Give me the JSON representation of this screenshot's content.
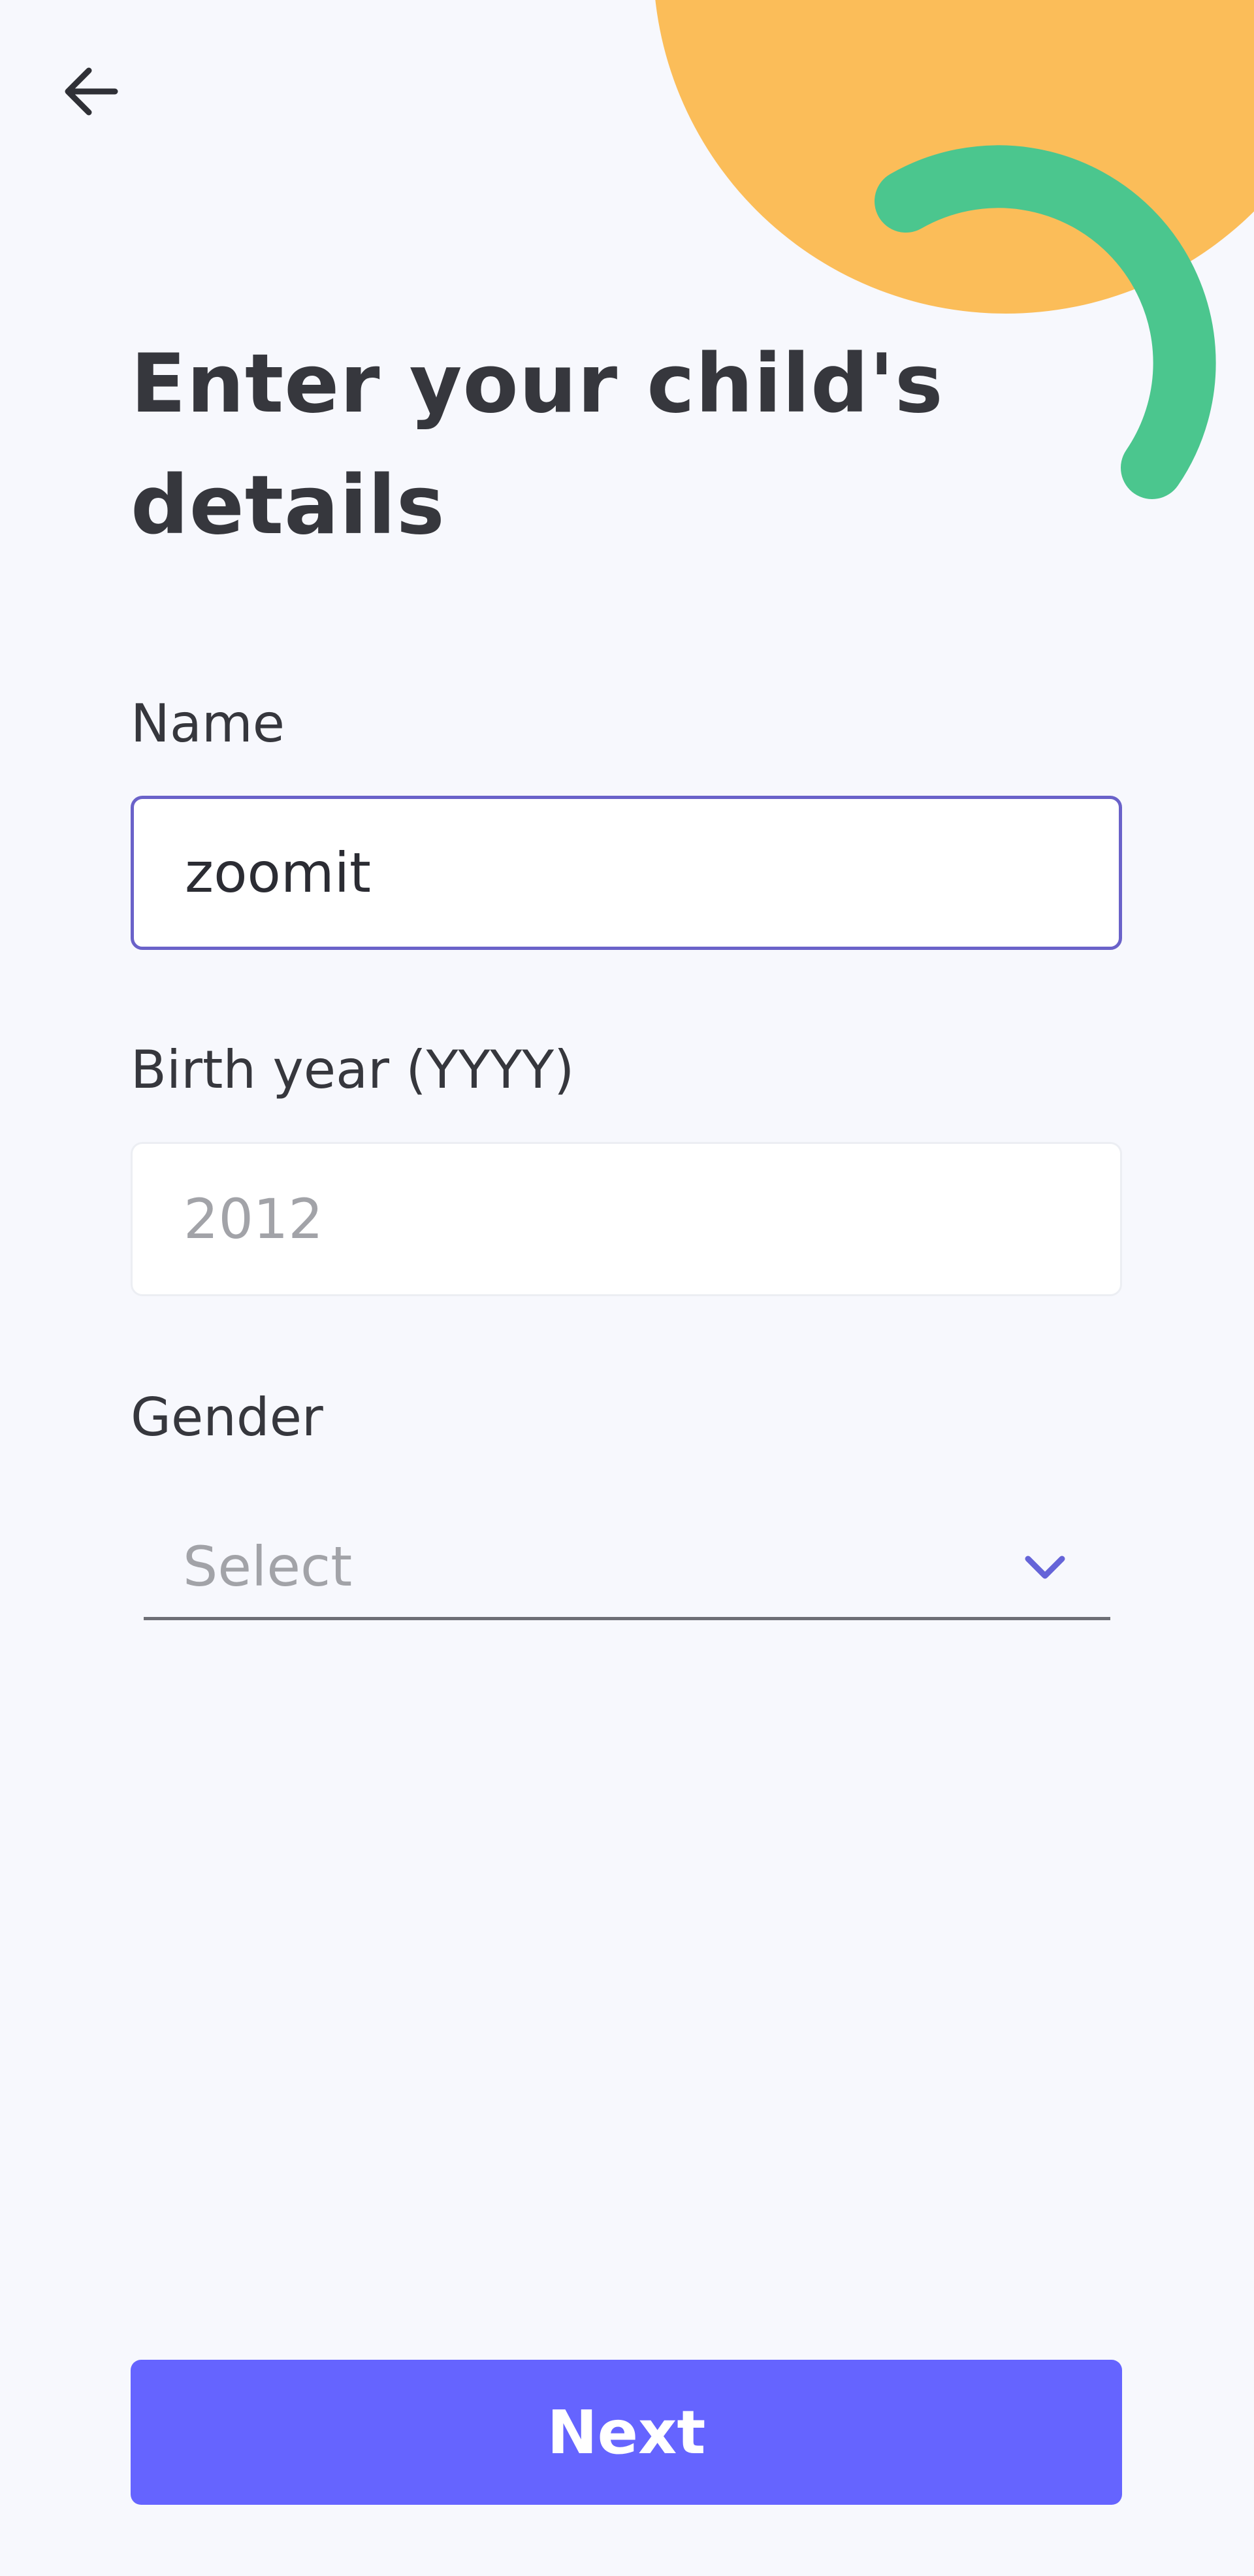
{
  "header": {
    "back_icon": "arrow-left-icon",
    "title": "Enter your child's details"
  },
  "form": {
    "name": {
      "label": "Name",
      "value": "zoomit"
    },
    "birth_year": {
      "label": "Birth year (YYYY)",
      "placeholder": "2012"
    },
    "gender": {
      "label": "Gender",
      "selected": "Select",
      "chevron_icon": "chevron-down-icon"
    }
  },
  "footer": {
    "next_label": "Next"
  },
  "colors": {
    "accent": "#6564ff",
    "input_focus_border": "#6a62c9",
    "decor_orange": "#fbbd59",
    "decor_green": "#4bc68e",
    "background": "#f7f8fd",
    "text": "#36373d"
  }
}
